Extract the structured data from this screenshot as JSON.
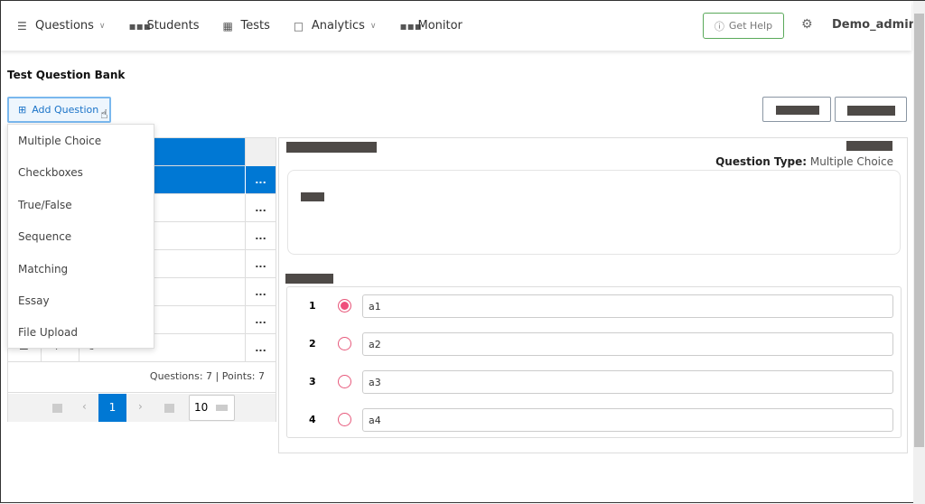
{
  "nav": {
    "items": [
      {
        "label": "Questions",
        "icon": "hamburger-icon",
        "dropdown": true
      },
      {
        "label": "Students",
        "icon": "people-icon"
      },
      {
        "label": "Tests",
        "icon": "calendar-grid-icon"
      },
      {
        "label": "Analytics",
        "icon": "calendar-icon",
        "dropdown": true
      },
      {
        "label": "Monitor",
        "icon": "people-icon"
      }
    ],
    "help": "Get Help",
    "user": "Demo_admin"
  },
  "page": {
    "title": "Test Question Bank",
    "add_question": "Add Question"
  },
  "menu": [
    "Multiple Choice",
    "Checkboxes",
    "True/False",
    "Sequence",
    "Matching",
    "Essay",
    "File Upload"
  ],
  "table": {
    "last_row": {
      "num": "7",
      "text": "s"
    },
    "row_action": "...",
    "footer": "Questions: 7 | Points: 7",
    "pager": {
      "page": "1",
      "page_size": "10"
    }
  },
  "detail": {
    "type_label": "Question Type:",
    "type_value": "Multiple Choice",
    "answers": [
      {
        "num": "1",
        "value": "a1",
        "selected": true
      },
      {
        "num": "2",
        "value": "a2"
      },
      {
        "num": "3",
        "value": "a3"
      },
      {
        "num": "4",
        "value": "a4"
      }
    ]
  },
  "colors": {
    "accent": "#0078d4",
    "radio": "#ef4f7c",
    "help_border": "#5aa95a"
  }
}
